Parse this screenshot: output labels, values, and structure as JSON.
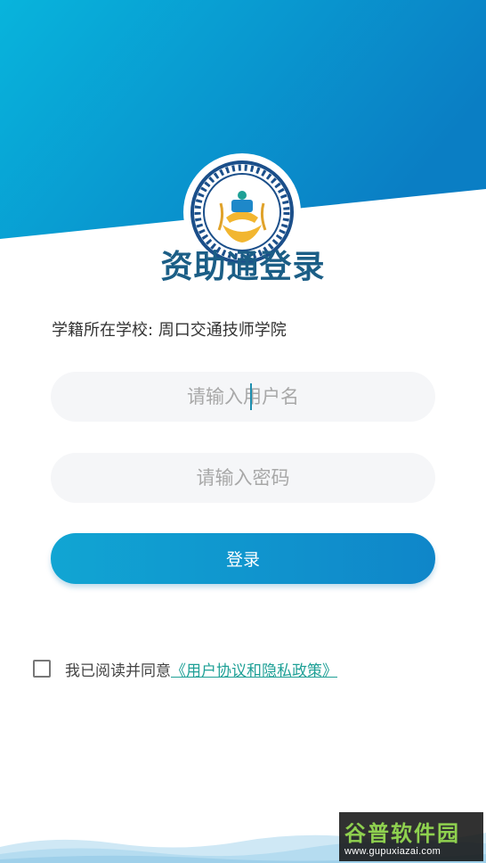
{
  "app": {
    "title": "资助通登录"
  },
  "school": {
    "label": "学籍所在学校:",
    "name": "周口交通技师学院"
  },
  "form": {
    "username_placeholder": "请输入用户名",
    "password_placeholder": "请输入密码",
    "login_label": "登录"
  },
  "agreement": {
    "prefix": "我已阅读并同意",
    "link": "《用户协议和隐私政策》",
    "checked": false
  },
  "watermark": {
    "brand": "谷普软件园",
    "url": "www.gupuxiazai.com"
  },
  "colors": {
    "header_start": "#08b4dc",
    "header_end": "#0a7ec4",
    "title": "#1b5e86",
    "link": "#1ea096",
    "button_start": "#11a5d3",
    "button_end": "#0f86c9"
  }
}
